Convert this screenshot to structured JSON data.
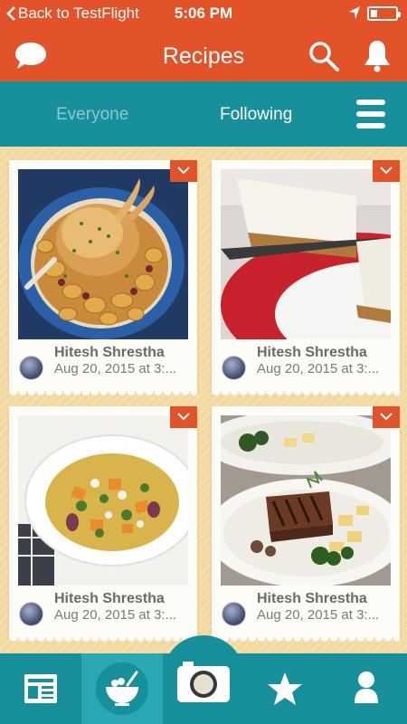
{
  "status_bar": {
    "back_label": "Back to TestFlight",
    "time": "5:06 PM",
    "battery_level": 0.25
  },
  "navbar": {
    "title": "Recipes",
    "icons": [
      "chat-bubble-icon",
      "search-icon",
      "bell-icon"
    ]
  },
  "segments": {
    "items": [
      "Everyone",
      "Following"
    ],
    "selected": "Following"
  },
  "feed": {
    "cards": [
      {
        "author": "Hitesh Shrestha",
        "date": "Aug 20, 2015 at 3:...",
        "photo": "roast-chicken-photo"
      },
      {
        "author": "Hitesh Shrestha",
        "date": "Aug 20, 2015 at 3:...",
        "photo": "cheesecake-photo"
      },
      {
        "author": "Hitesh Shrestha",
        "date": "Aug 20, 2015 at 3:...",
        "photo": "pasta-salad-photo"
      },
      {
        "author": "Hitesh Shrestha",
        "date": "Aug 20, 2015 at 3:...",
        "photo": "steak-plate-photo"
      }
    ]
  },
  "tabbar": {
    "tabs": [
      "news-feed-icon",
      "recipe-bowl-icon",
      "camera-icon",
      "star-icon",
      "profile-icon"
    ],
    "active": "recipe-bowl-icon"
  },
  "colors": {
    "header": "#e2532a",
    "accent": "#17909c",
    "active_tab": "#2aa7b2",
    "background": "#f3d9a0"
  }
}
